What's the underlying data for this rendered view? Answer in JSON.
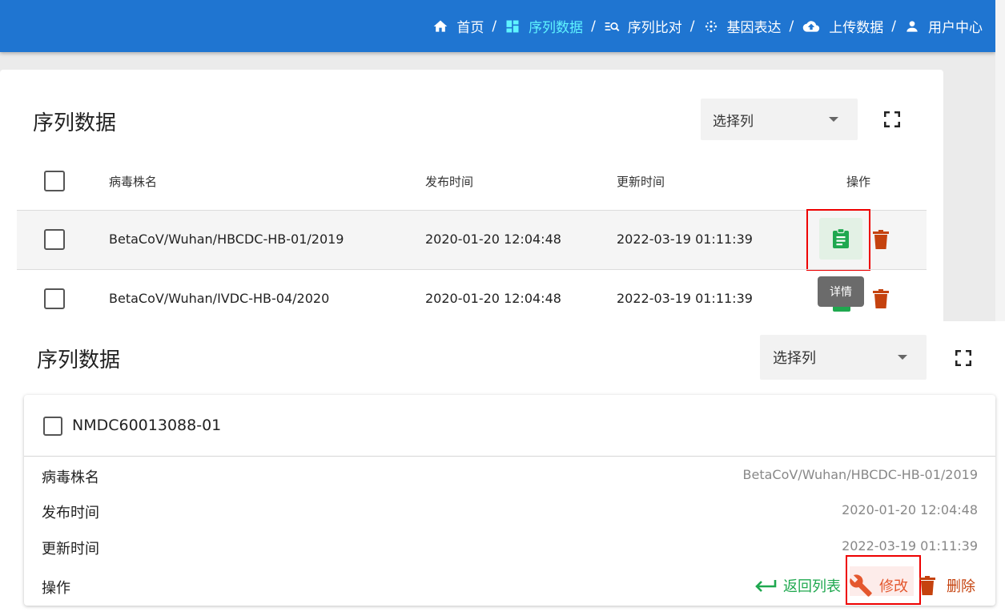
{
  "nav": {
    "items": [
      {
        "label": "首页",
        "icon": "home-icon",
        "active": false
      },
      {
        "label": "序列数据",
        "icon": "dashboard-icon",
        "active": true
      },
      {
        "label": "序列比对",
        "icon": "sequence-search-icon",
        "active": false
      },
      {
        "label": "基因表达",
        "icon": "gene-expression-icon",
        "active": false
      },
      {
        "label": "上传数据",
        "icon": "cloud-upload-icon",
        "active": false
      },
      {
        "label": "用户中心",
        "icon": "user-icon",
        "active": false
      }
    ],
    "separator": "/"
  },
  "table_view": {
    "title": "序列数据",
    "column_select": {
      "label": "选择列"
    },
    "headers": {
      "name": "病毒株名",
      "published": "发布时间",
      "updated": "更新时间",
      "actions": "操作"
    },
    "rows": [
      {
        "name": "BetaCoV/Wuhan/HBCDC-HB-01/2019",
        "published": "2020-01-20 12:04:48",
        "updated": "2022-03-19 01:11:39"
      },
      {
        "name": "BetaCoV/Wuhan/IVDC-HB-04/2020",
        "published": "2020-01-20 12:04:48",
        "updated": "2022-03-19 01:11:39"
      }
    ],
    "tooltip": "详情"
  },
  "card_view": {
    "title": "序列数据",
    "column_select": {
      "label": "选择列"
    },
    "record": {
      "id": "NMDC60013088-01",
      "fields": [
        {
          "label": "病毒株名",
          "value": "BetaCoV/Wuhan/HBCDC-HB-01/2019"
        },
        {
          "label": "发布时间",
          "value": "2020-01-20 12:04:48"
        },
        {
          "label": "更新时间",
          "value": "2022-03-19 01:11:39"
        }
      ],
      "actions_label": "操作",
      "back_label": "返回列表",
      "edit_label": "修改",
      "delete_label": "删除"
    }
  },
  "colors": {
    "appbar": "#1f75d1",
    "nav_active": "#5ff4ff",
    "detail_green": "#1fa84f",
    "delete_red": "#c5420e",
    "edit_orange": "#e4572e",
    "highlight_box": "#e00000"
  }
}
